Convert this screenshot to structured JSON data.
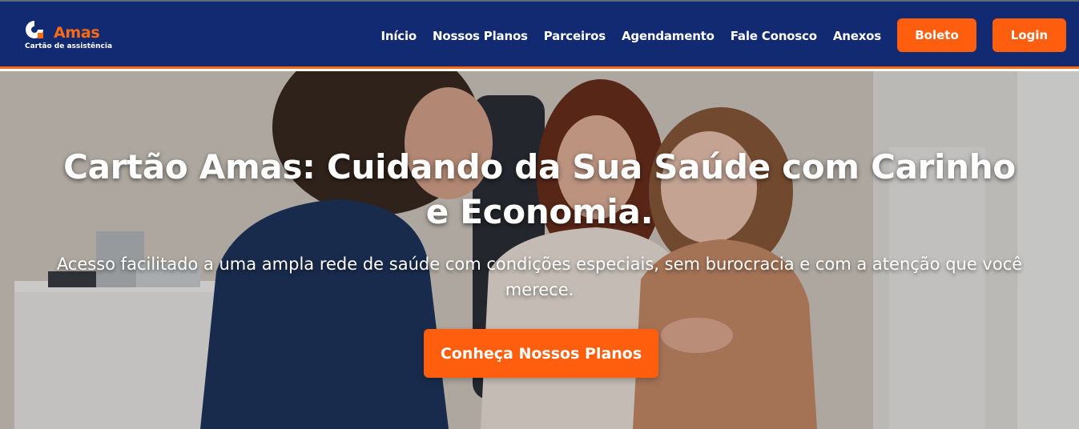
{
  "brand": {
    "name": "Amas",
    "tagline": "Cartão de assistência",
    "colors": {
      "navy": "#112a72",
      "orange": "#ff5e0e"
    }
  },
  "nav": {
    "items": [
      {
        "label": "Início"
      },
      {
        "label": "Nossos Planos"
      },
      {
        "label": "Parceiros"
      },
      {
        "label": "Agendamento"
      },
      {
        "label": "Fale Conosco"
      },
      {
        "label": "Anexos"
      }
    ],
    "boleto_label": "Boleto",
    "login_label": "Login"
  },
  "hero": {
    "title": "Cartão Amas: Cuidando da Sua Saúde com Carinho e Economia.",
    "subtitle": "Acesso facilitado a uma ampla rede de saúde com condições especiais, sem burocracia e com a atenção que você merece.",
    "cta_label": "Conheça Nossos Planos",
    "image_icon": "family-doctor-photo"
  }
}
